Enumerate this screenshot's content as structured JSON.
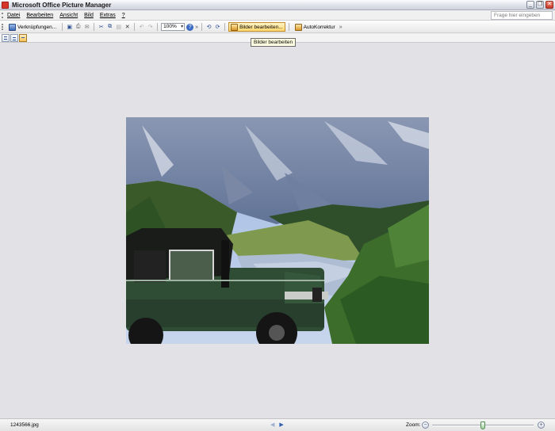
{
  "window": {
    "title": "Microsoft Office Picture Manager"
  },
  "menu": {
    "items": [
      "Datei",
      "Bearbeiten",
      "Ansicht",
      "Bild",
      "Extras",
      "?"
    ],
    "help_placeholder": "Frage hier eingeben"
  },
  "toolbar": {
    "shortcuts_label": "Verknüpfungen...",
    "zoom_value": "100%",
    "edit_pictures_label": "Bilder bearbeiten...",
    "autocorrect_label": "AutoKorrektur"
  },
  "tooltip": {
    "text": "Bilder bearbeiten"
  },
  "status": {
    "filename": "1243566.jpg",
    "zoom_label": "Zoom:",
    "zoom_level": 0.5
  },
  "icons": {
    "app": "picture-manager-icon",
    "shortcuts": "shortcuts-icon",
    "save": "save-icon",
    "print": "print-icon",
    "email": "email-icon",
    "cut": "cut-icon",
    "copy": "copy-icon",
    "paste": "paste-icon",
    "delete": "delete-icon",
    "undo": "undo-icon",
    "redo": "redo-icon",
    "rotate_left": "rotate-left-icon",
    "rotate_right": "rotate-right-icon",
    "edit_pictures": "edit-pictures-icon",
    "autocorrect": "autocorrect-icon",
    "view_thumbnails": "thumbnail-view-icon",
    "view_filmstrip": "filmstrip-view-icon",
    "view_single": "single-picture-view-icon"
  },
  "colors": {
    "accent": "#2f5fb0",
    "hot_button": "#ffd86b",
    "tooltip_bg": "#ffffe1"
  }
}
